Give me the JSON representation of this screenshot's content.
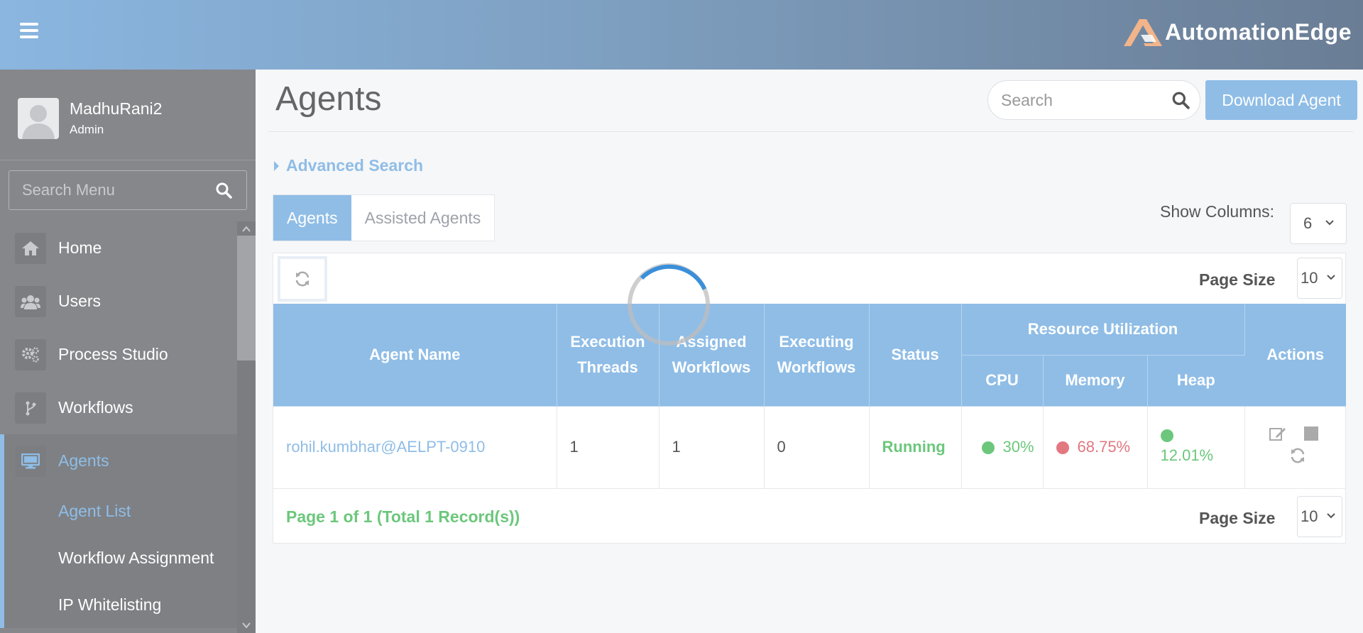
{
  "header": {
    "logo_text": "AutomationEdge"
  },
  "user": {
    "name": "MadhuRani2",
    "role": "Admin"
  },
  "sidebar": {
    "search_placeholder": "Search Menu",
    "items": [
      {
        "label": "Home",
        "icon": "home-icon"
      },
      {
        "label": "Users",
        "icon": "users-icon"
      },
      {
        "label": "Process Studio",
        "icon": "gears-icon"
      },
      {
        "label": "Workflows",
        "icon": "workflow-icon"
      },
      {
        "label": "Agents",
        "icon": "desktop-icon"
      }
    ],
    "subitems": [
      {
        "label": "Agent List"
      },
      {
        "label": "Workflow Assignment"
      },
      {
        "label": "IP Whitelisting"
      }
    ]
  },
  "main": {
    "title": "Agents",
    "search_placeholder": "Search",
    "download_label": "Download Agent",
    "advanced_search": "Advanced Search",
    "tabs": [
      {
        "label": "Agents"
      },
      {
        "label": "Assisted Agents"
      }
    ],
    "show_columns_label": "Show Columns:",
    "show_columns_value": "6",
    "page_size_label": "Page Size",
    "page_size_value": "10",
    "table": {
      "headers": {
        "agent_name": "Agent Name",
        "exec_threads_1": "Execution",
        "exec_threads_2": "Threads",
        "assigned_1": "Assigned",
        "assigned_2": "Workflows",
        "executing_1": "Executing",
        "executing_2": "Workflows",
        "status": "Status",
        "resource": "Resource Utilization",
        "cpu": "CPU",
        "memory": "Memory",
        "heap": "Heap",
        "actions": "Actions"
      },
      "rows": [
        {
          "agent_name": "rohil.kumbhar@AELPT-0910",
          "execution_threads": "1",
          "assigned_workflows": "1",
          "executing_workflows": "0",
          "status": "Running",
          "cpu": "30%",
          "memory": "68.75%",
          "heap": "12.01%"
        }
      ]
    },
    "pagination": "Page 1 of 1 (Total 1 Record(s))"
  },
  "colors": {
    "accent": "#8fbde6",
    "success": "#6cc77c",
    "danger": "#e27880",
    "sidebar": "#85878b"
  }
}
